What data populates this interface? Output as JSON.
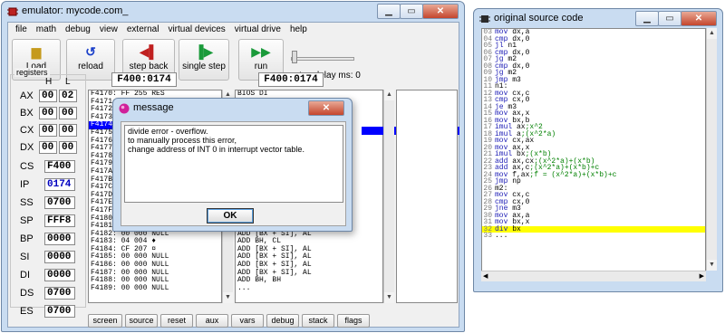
{
  "emulator": {
    "title": "emulator: mycode.com_",
    "menu": [
      "file",
      "math",
      "debug",
      "view",
      "external",
      "virtual devices",
      "virtual drive",
      "help"
    ],
    "toolbar": [
      {
        "label": "Load",
        "icon": "folder-icon",
        "glyph": "📂"
      },
      {
        "label": "reload",
        "icon": "reload-icon",
        "glyph": "↺"
      },
      {
        "label": "step back",
        "icon": "step-back-icon",
        "glyph": "◀┃"
      },
      {
        "label": "single step",
        "icon": "single-step-icon",
        "glyph": "┃▶"
      },
      {
        "label": "run",
        "icon": "run-icon",
        "glyph": "▶▶"
      }
    ],
    "step_delay_label": "step delay ms: 0",
    "registers_title": "registers",
    "col_h": "H",
    "col_l": "L",
    "registers": [
      {
        "name": "AX",
        "h": "00",
        "l": "02"
      },
      {
        "name": "BX",
        "h": "00",
        "l": "00"
      },
      {
        "name": "CX",
        "h": "00",
        "l": "00"
      },
      {
        "name": "DX",
        "h": "00",
        "l": "00"
      }
    ],
    "seg_registers": [
      {
        "name": "CS",
        "value": "F400"
      },
      {
        "name": "IP",
        "value": "0174"
      },
      {
        "name": "SS",
        "value": "0700"
      },
      {
        "name": "SP",
        "value": "FFF8"
      },
      {
        "name": "BP",
        "value": "0000"
      },
      {
        "name": "SI",
        "value": "0000"
      },
      {
        "name": "DI",
        "value": "0000"
      },
      {
        "name": "DS",
        "value": "0700"
      },
      {
        "name": "ES",
        "value": "0700"
      }
    ],
    "mem_address": "F400:0174",
    "dis_address": "F400:0174",
    "memory_lines": [
      "F4170: FF 255 RES",
      "F4171: FF 255 RES",
      "F4172: FF 255 RES",
      "F4173: FF 255 RES",
      "F4174: CF 207 ¤",
      "F4175: 00 000 NULL",
      "F4176: 00 000 NULL",
      "F4177: 00 000 NULL",
      "F4178: 00 000 NULL",
      "F4179: 00 000 NULL",
      "F417A: 00 000 NULL",
      "F417B: 00 000 NULL",
      "F417C: 00 000 NULL",
      "F417D: 00 000 NULL",
      "F417E: 00 000 NULL",
      "F417F: 00 000 NULL",
      "F4180: 00 000 NULL",
      "F4181: 00 000 NULL",
      "F4182: 00 000 NULL",
      "F4183: 04 004 ♦",
      "F4184: CF 207 ¤",
      "F4185: 00 000 NULL",
      "F4186: 00 000 NULL",
      "F4187: 00 000 NULL",
      "F4188: 00 000 NULL",
      "F4189: 00 000 NULL"
    ],
    "disasm_lines": [
      "BIOS DI",
      "INT 0FFh",
      "...",
      "IRET",
      "ADD [BX + SI], AL",
      "ADD [BX + SI], AL",
      "ADD [BX + SI], AL",
      "ADD [BX + SI], AL",
      "ADD [BX + SI], AL",
      "ADD [BX + SI], AL",
      "ADD [BX + SI], AL",
      "ADD [BX + SI], AL",
      "ADD [BX + SI], AL",
      "ADD [BX + SI], AL",
      "ADD [BX + SI], AL",
      "ADD [BX + SI], AL",
      "ADD [BX + SI], AL",
      "ADD [BX + SI], AL",
      "ADD [BX + SI], AL",
      "ADD BH, CL",
      "ADD [BX + SI], AL",
      "ADD [BX + SI], AL",
      "ADD [BX + SI], AL",
      "ADD [BX + SI], AL",
      "ADD BH, BH",
      "..."
    ],
    "bottom_buttons": [
      "screen",
      "source",
      "reset",
      "aux",
      "vars",
      "debug",
      "stack",
      "flags"
    ]
  },
  "source": {
    "title": "original source code",
    "lines": [
      {
        "n": "03",
        "t": "mov dx,a"
      },
      {
        "n": "04",
        "t": "cmp dx,0"
      },
      {
        "n": "05",
        "t": "jl n1"
      },
      {
        "n": "06",
        "t": "cmp dx,0"
      },
      {
        "n": "07",
        "t": "jg m2"
      },
      {
        "n": "08",
        "t": "cmp dx,0"
      },
      {
        "n": "09",
        "t": "jg m2"
      },
      {
        "n": "10",
        "t": "jmp m3"
      },
      {
        "n": "11",
        "t": "n1:"
      },
      {
        "n": "12",
        "t": "mov cx,c"
      },
      {
        "n": "13",
        "t": "cmp cx,0"
      },
      {
        "n": "14",
        "t": "je m3"
      },
      {
        "n": "15",
        "t": "mov ax,x"
      },
      {
        "n": "16",
        "t": "mov bx,b"
      },
      {
        "n": "17",
        "t": "imul ax;x^2"
      },
      {
        "n": "18",
        "t": "imul a;(x^2*a)"
      },
      {
        "n": "19",
        "t": "mov cx,ax"
      },
      {
        "n": "20",
        "t": "mov ax,x"
      },
      {
        "n": "21",
        "t": "imul bx;(x*b)"
      },
      {
        "n": "22",
        "t": "add ax,cx;(x^2*a)+(x*b)"
      },
      {
        "n": "23",
        "t": "add ax,c;(x^2*a)+(x*b)+c"
      },
      {
        "n": "24",
        "t": "mov f,ax;f = (x^2*a)+(x*b)+c"
      },
      {
        "n": "25",
        "t": "jmp np"
      },
      {
        "n": "26",
        "t": "m2:"
      },
      {
        "n": "27",
        "t": "mov cx,c"
      },
      {
        "n": "28",
        "t": "cmp cx,0"
      },
      {
        "n": "29",
        "t": "jne m3"
      },
      {
        "n": "30",
        "t": "mov ax,a"
      },
      {
        "n": "31",
        "t": "mov bx,x"
      },
      {
        "n": "32",
        "t": "div bx"
      },
      {
        "n": "33",
        "t": "..."
      }
    ],
    "highlight_line": "32"
  },
  "dialog": {
    "title": "message",
    "line1": "divide error - overflow.",
    "line2": "to manually process this error,",
    "line3": "change address of INT 0 in interrupt vector table.",
    "ok": "OK"
  }
}
